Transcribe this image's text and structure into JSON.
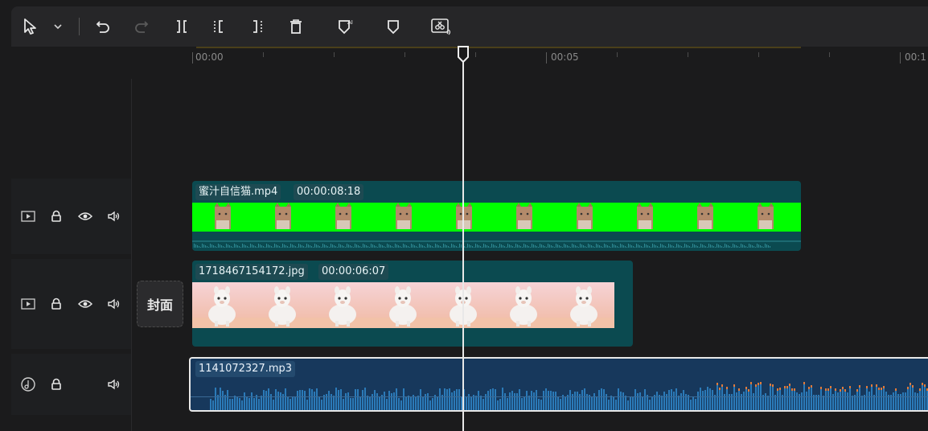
{
  "toolbar": {
    "buttons": [
      {
        "name": "select-tool-icon"
      },
      {
        "name": "chevron-down-icon"
      },
      {
        "name": "undo-icon"
      },
      {
        "name": "redo-icon"
      },
      {
        "name": "split-icon"
      },
      {
        "name": "trim-left-icon"
      },
      {
        "name": "trim-right-icon"
      },
      {
        "name": "delete-icon"
      },
      {
        "name": "marker-ai-icon"
      },
      {
        "name": "marker-icon"
      },
      {
        "name": "auto-cut-icon"
      }
    ]
  },
  "ruler": {
    "labels": [
      "00:00",
      "00:05",
      "00:1"
    ]
  },
  "tracks": [
    {
      "type": "video",
      "icons": [
        "video-track-icon",
        "lock-icon",
        "eye-icon",
        "volume-icon"
      ]
    },
    {
      "type": "image",
      "icons": [
        "video-track-icon",
        "lock-icon",
        "eye-icon",
        "volume-icon"
      ]
    },
    {
      "type": "audio",
      "icons": [
        "music-note-icon",
        "lock-icon",
        "volume-icon"
      ]
    }
  ],
  "cover_label": "封面",
  "clips": {
    "video": {
      "name": "蜜汁自信猫.mp4",
      "duration": "00:00:08:18",
      "background": "#00ff00"
    },
    "image": {
      "name": "1718467154172.jpg",
      "duration": "00:00:06:07"
    },
    "audio": {
      "name": "1141072327.mp3"
    }
  },
  "colors": {
    "clip_bg": "#0b4a50",
    "audio_bg": "#17385c",
    "wave": "#2b7ab8",
    "peak": "#e07a3a",
    "green_screen": "#00ff00"
  }
}
